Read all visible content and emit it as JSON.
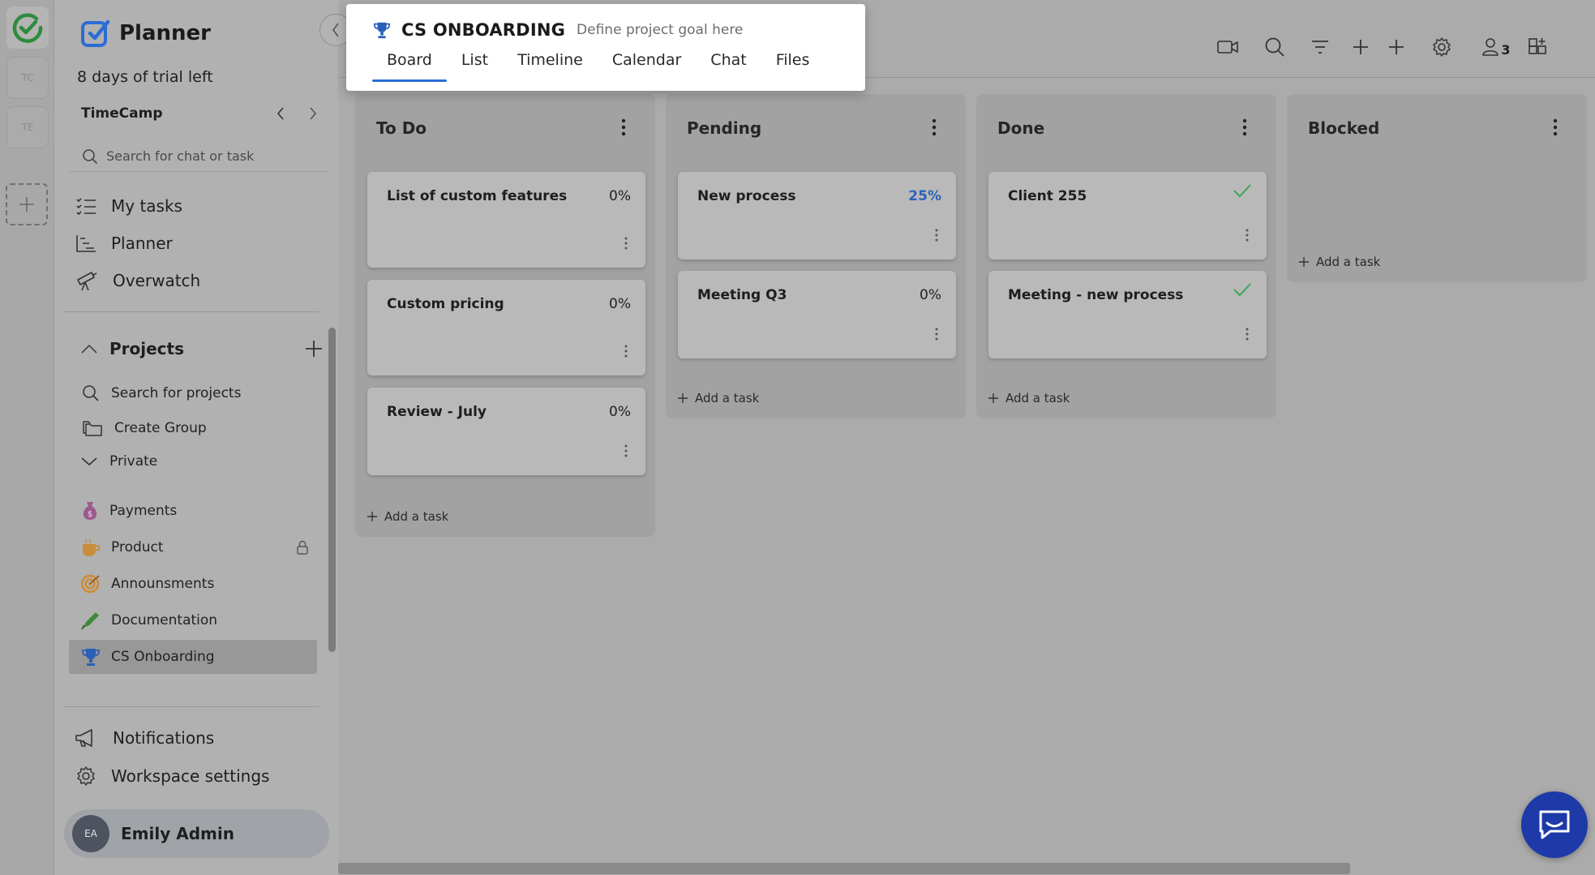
{
  "app": {
    "name": "Planner",
    "trial_text": "8 days of trial left"
  },
  "rail": {
    "workspaces": [
      "TC",
      "TE"
    ]
  },
  "workspace": {
    "name": "TimeCamp"
  },
  "search": {
    "placeholder": "Search for chat or task"
  },
  "nav": {
    "my_tasks": "My tasks",
    "planner": "Planner",
    "overwatch": "Overwatch"
  },
  "projects": {
    "label": "Projects",
    "search_label": "Search for projects",
    "create_group": "Create Group",
    "private": "Private",
    "items": [
      {
        "label": "Payments",
        "icon": "money-bag-icon"
      },
      {
        "label": "Product",
        "icon": "coffee-icon",
        "locked": true
      },
      {
        "label": "Announsments",
        "icon": "target-icon"
      },
      {
        "label": "Documentation",
        "icon": "pen-icon"
      },
      {
        "label": "CS Onboarding",
        "icon": "trophy-icon",
        "active": true
      }
    ]
  },
  "footer": {
    "notifications": "Notifications",
    "workspace_settings": "Workspace settings"
  },
  "user": {
    "initials": "EA",
    "name": "Emily Admin"
  },
  "project": {
    "name": "CS ONBOARDING",
    "goal_placeholder": "Define project goal here",
    "tabs": [
      "Board",
      "List",
      "Timeline",
      "Calendar",
      "Chat",
      "Files"
    ],
    "active_tab": "Board"
  },
  "toolbar": {
    "members_count": "3"
  },
  "board": {
    "add_task": "Add a task",
    "columns": [
      {
        "title": "To Do",
        "cards": [
          {
            "title": "List of custom features",
            "progress": "0%"
          },
          {
            "title": "Custom pricing",
            "progress": "0%"
          },
          {
            "title": "Review - July",
            "progress": "0%"
          }
        ]
      },
      {
        "title": "Pending",
        "cards": [
          {
            "title": "New process",
            "progress": "25%"
          },
          {
            "title": "Meeting Q3",
            "progress": "0%"
          }
        ]
      },
      {
        "title": "Done",
        "cards": [
          {
            "title": "Client 255",
            "done": true
          },
          {
            "title": "Meeting - new process",
            "done": true
          }
        ]
      },
      {
        "title": "Blocked",
        "cards": []
      }
    ]
  },
  "colors": {
    "accent": "#2b6cd6",
    "brand_green": "#2e8b3e",
    "check_green": "#3aa655",
    "chat_bubble": "#1e3aa8"
  }
}
